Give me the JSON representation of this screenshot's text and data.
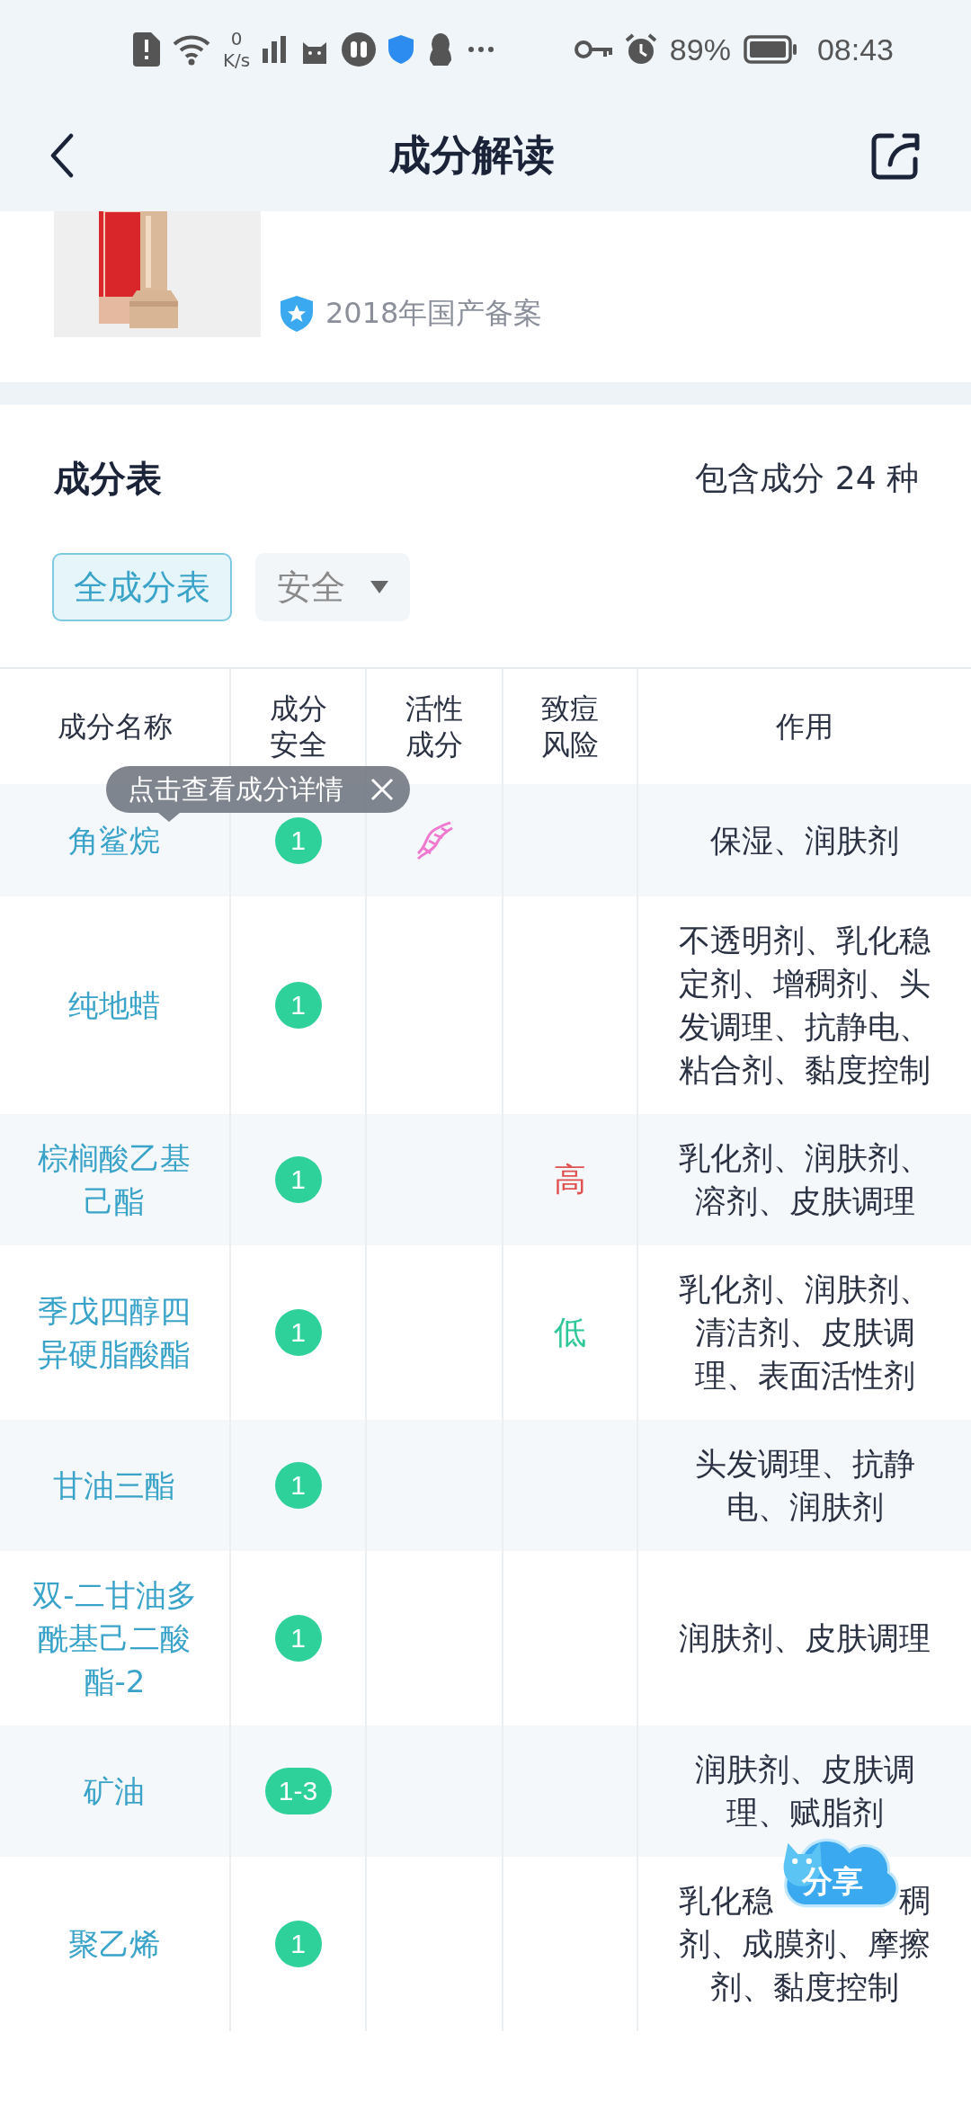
{
  "status_bar": {
    "net_speed_value": "0",
    "net_speed_unit": "K/s",
    "battery": "89%",
    "time": "08:43"
  },
  "header": {
    "title": "成分解读"
  },
  "product": {
    "filing": "2018年国产备案"
  },
  "ingredients": {
    "title": "成分表",
    "count": "包含成分 24 种",
    "filters": [
      {
        "label": "全成分表",
        "selected": true,
        "kind": "tab"
      },
      {
        "label": "安全",
        "selected": false,
        "kind": "dropdown"
      }
    ],
    "table": {
      "columns": [
        "成分名称",
        "成分安全",
        "活性成分",
        "致痘风险",
        "作用"
      ],
      "rows": [
        {
          "name": "角鲨烷",
          "safety": "1",
          "active": true,
          "function": "保湿、润肤剂"
        },
        {
          "name": "纯地蜡",
          "safety": "1",
          "active": false,
          "function": "不透明剂、乳化稳定剂、增稠剂、头发调理、抗静电、粘合剂、黏度控制"
        },
        {
          "name": "棕榈酸乙基己酯",
          "safety": "1",
          "active": false,
          "acne_risk": {
            "text": "高",
            "kind": "high"
          },
          "function": "乳化剂、润肤剂、溶剂、皮肤调理"
        },
        {
          "name": "季戊四醇四异硬脂酸酯",
          "safety": "1",
          "active": false,
          "acne_risk": {
            "text": "低",
            "kind": "low"
          },
          "function": "乳化剂、润肤剂、清洁剂、皮肤调理、表面活性剂"
        },
        {
          "name": "甘油三酯",
          "safety": "1",
          "active": false,
          "function": "头发调理、抗静电、润肤剂"
        },
        {
          "name": "双-二甘油多酰基己二酸酯-2",
          "safety": "1",
          "active": false,
          "function": "润肤剂、皮肤调理"
        },
        {
          "name": "矿油",
          "safety": "1-3",
          "active": false,
          "function": "润肤剂、皮肤调理、赋脂剂"
        },
        {
          "name": "聚乙烯",
          "safety": "1",
          "active": false,
          "function_lines": [
            [
              "乳化稳",
              "稠"
            ],
            [
              "剂、成膜剂、摩擦"
            ],
            [
              "剂、黏度控制"
            ]
          ]
        }
      ]
    }
  },
  "tooltip": {
    "text": "点击查看成分详情"
  },
  "share_button": {
    "label": "分享"
  }
}
